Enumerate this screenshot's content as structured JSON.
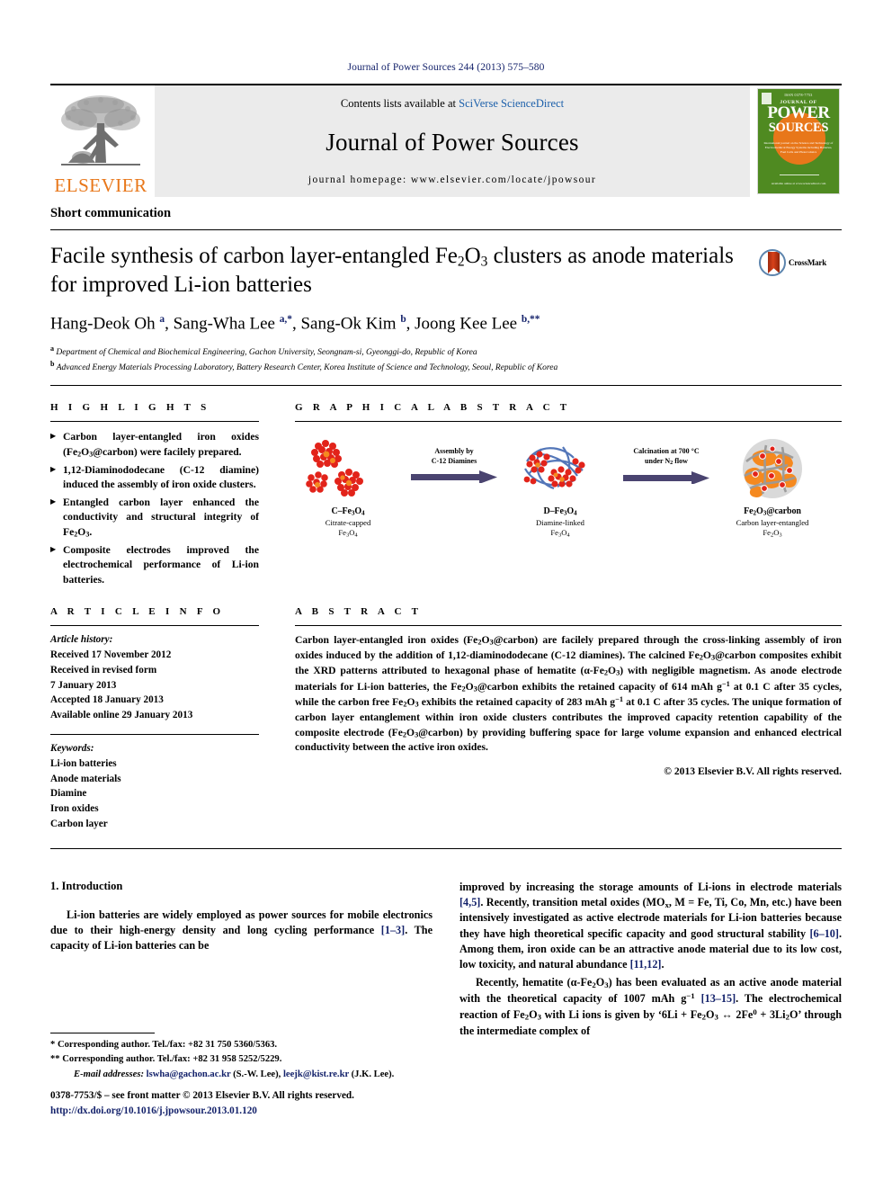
{
  "running_head": "Journal of Power Sources 244 (2013) 575–580",
  "masthead": {
    "publisher_name": "ELSEVIER",
    "contents_prefix": "Contents lists available at ",
    "contents_link": "SciVerse ScienceDirect",
    "journal_name": "Journal of Power Sources",
    "homepage": "journal homepage: www.elsevier.com/locate/jpowsour",
    "cover": {
      "top_note": "ISSN 0378-7753",
      "jof": "JOURNAL OF",
      "power": "POWER",
      "sources": "SOURCES",
      "subtitle": "International journal on the Science and Technology of Electrochemical Energy Systems including Batteries, Fuel Cells and Photovoltaics",
      "footer": "Available online at www.sciencedirect.com"
    }
  },
  "article": {
    "type": "Short communication",
    "title_part1": "Facile synthesis of carbon layer-entangled Fe",
    "title_sub1": "2",
    "title_part2": "O",
    "title_sub2": "3",
    "title_part3": " clusters as anode materials for improved Li-ion batteries",
    "crossmark_label": "CrossMark",
    "authors_html": "Hang-Deok Oh <sup>a</sup>, Sang-Wha Lee <sup>a,*</sup>, Sang-Ok Kim <sup>b</sup>, Joong Kee Lee <sup>b,**</sup>",
    "affiliations": [
      "Department of Chemical and Biochemical Engineering, Gachon University, Seongnam-si, Gyeonggi-do, Republic of Korea",
      "Advanced Energy Materials Processing Laboratory, Battery Research Center, Korea Institute of Science and Technology, Seoul, Republic of Korea"
    ]
  },
  "highlights": {
    "heading": "H I G H L I G H T S",
    "items": [
      "Carbon layer-entangled iron oxides (Fe<sub>2</sub>O<sub>3</sub>@carbon) were facilely prepared.",
      "1,12-Diaminododecane (C-12 diamine) induced the assembly of iron oxide clusters.",
      "Entangled carbon layer enhanced the conductivity and structural integrity of Fe<sub>2</sub>O<sub>3</sub>.",
      "Composite electrodes improved the electrochemical performance of Li-ion batteries."
    ]
  },
  "graphical_abstract": {
    "heading": "G R A P H I C A L   A B S T R A C T",
    "stages": [
      {
        "label_html": "C&#8211;Fe<sub>3</sub>O<sub>4</sub>",
        "sub_html": "Citrate-capped<br>Fe<sub>3</sub>O<sub>4</sub>"
      },
      {
        "label_html": "D&#8211;Fe<sub>3</sub>O<sub>4</sub>",
        "sub_html": "Diamine-linked<br>Fe<sub>3</sub>O<sub>4</sub>"
      },
      {
        "label_html": "Fe<sub>2</sub>O<sub>3</sub>@carbon",
        "sub_html": "Carbon layer-entangled<br>Fe<sub>2</sub>O<sub>3</sub>"
      }
    ],
    "arrows": [
      "Assembly by<br>C-12 Diamines",
      "Calcination at 700 &#176;C<br>under N<sub>2</sub> flow"
    ]
  },
  "article_info": {
    "heading": "A R T I C L E   I N F O",
    "history_label": "Article history:",
    "history": [
      "Received 17 November 2012",
      "Received in revised form",
      "7 January 2013",
      "Accepted 18 January 2013",
      "Available online 29 January 2013"
    ],
    "keywords_label": "Keywords:",
    "keywords": [
      "Li-ion batteries",
      "Anode materials",
      "Diamine",
      "Iron oxides",
      "Carbon layer"
    ]
  },
  "abstract": {
    "heading": "A B S T R A C T",
    "text_html": "Carbon layer-entangled iron oxides (Fe<sub>2</sub>O<sub>3</sub>@carbon) are facilely prepared through the cross-linking assembly of iron oxides induced by the addition of 1,12-diaminododecane (C-12 diamines). The calcined Fe<sub>2</sub>O<sub>3</sub>@carbon composites exhibit the XRD patterns attributed to hexagonal phase of hematite (&#945;-Fe<sub>2</sub>O<sub>3</sub>) with negligible magnetism. As anode electrode materials for Li-ion batteries, the Fe<sub>2</sub>O<sub>3</sub>@carbon exhibits the retained capacity of 614 mAh g<sup>&#8722;1</sup> at 0.1 C after 35 cycles, while the carbon free Fe<sub>2</sub>O<sub>3</sub> exhibits the retained capacity of 283 mAh g<sup>&#8722;1</sup> at 0.1 C after 35 cycles. The unique formation of carbon layer entanglement within iron oxide clusters contributes the improved capacity retention capability of the composite electrode (Fe<sub>2</sub>O<sub>3</sub>@carbon) by providing buffering space for large volume expansion and enhanced electrical conductivity between the active iron oxides.",
    "copyright": "&#169; 2013 Elsevier B.V. All rights reserved."
  },
  "introduction": {
    "heading": "1.  Introduction",
    "paragraph_left_html": "Li-ion batteries are widely employed as power sources for mobile electronics due to their high-energy density and long cycling performance <span class=\"ref\">[1&#8211;3]</span>. The capacity of Li-ion batteries can be",
    "paragraph_right_1_html": "improved by increasing the storage amounts of Li-ions in electrode materials <span class=\"ref\">[4,5]</span>. Recently, transition metal oxides (MO<sub>x</sub>, M = Fe, Ti, Co, Mn, etc.) have been intensively investigated as active electrode materials for Li-ion batteries because they have high theoretical specific capacity and good structural stability <span class=\"ref\">[6&#8211;10]</span>. Among them, iron oxide can be an attractive anode material due to its low cost, low toxicity, and natural abundance <span class=\"ref\">[11,12]</span>.",
    "paragraph_right_2_html": "Recently, hematite (&#945;-Fe<sub>2</sub>O<sub>3</sub>) has been evaluated as an active anode material with the theoretical capacity of 1007 mAh g<sup>&#8722;1</sup> <span class=\"ref\">[13&#8211;15]</span>. The electrochemical reaction of Fe<sub>2</sub>O<sub>3</sub> with Li ions is given by &#8216;6Li + Fe<sub>2</sub>O<sub>3</sub> &#8596; 2Fe<sup>0</sup> + 3Li<sub>2</sub>O&#8217; through the intermediate complex of"
  },
  "footnotes": {
    "line1_html": "* Corresponding author. Tel./fax: +82 31 750 5360/5363.",
    "line2_html": "** Corresponding author. Tel./fax: +82 31 958 5252/5229.",
    "line3_html": "<span class=\"em\">E-mail addresses:</span> <span class=\"link\">lswha@gachon.ac.kr</span> (S.-W. Lee), <span class=\"link\">leejk@kist.re.kr</span> (J.K. Lee)."
  },
  "issn": {
    "line1_html": "0378-7753/$ &#8211; see front matter &#169; 2013 Elsevier B.V. All rights reserved.",
    "line2_html": "<span class=\"link\">http://dx.doi.org/10.1016/j.jpowsour.2013.01.120</span>"
  },
  "colors": {
    "link_blue": "#1b5faa",
    "ref_blue": "#14226b",
    "elsevier_orange": "#e8771a",
    "cover_green": "#4f8a21",
    "arrow_purple": "#4a4470",
    "particle_red": "#e2231a",
    "particle_orange": "#f5891f"
  }
}
